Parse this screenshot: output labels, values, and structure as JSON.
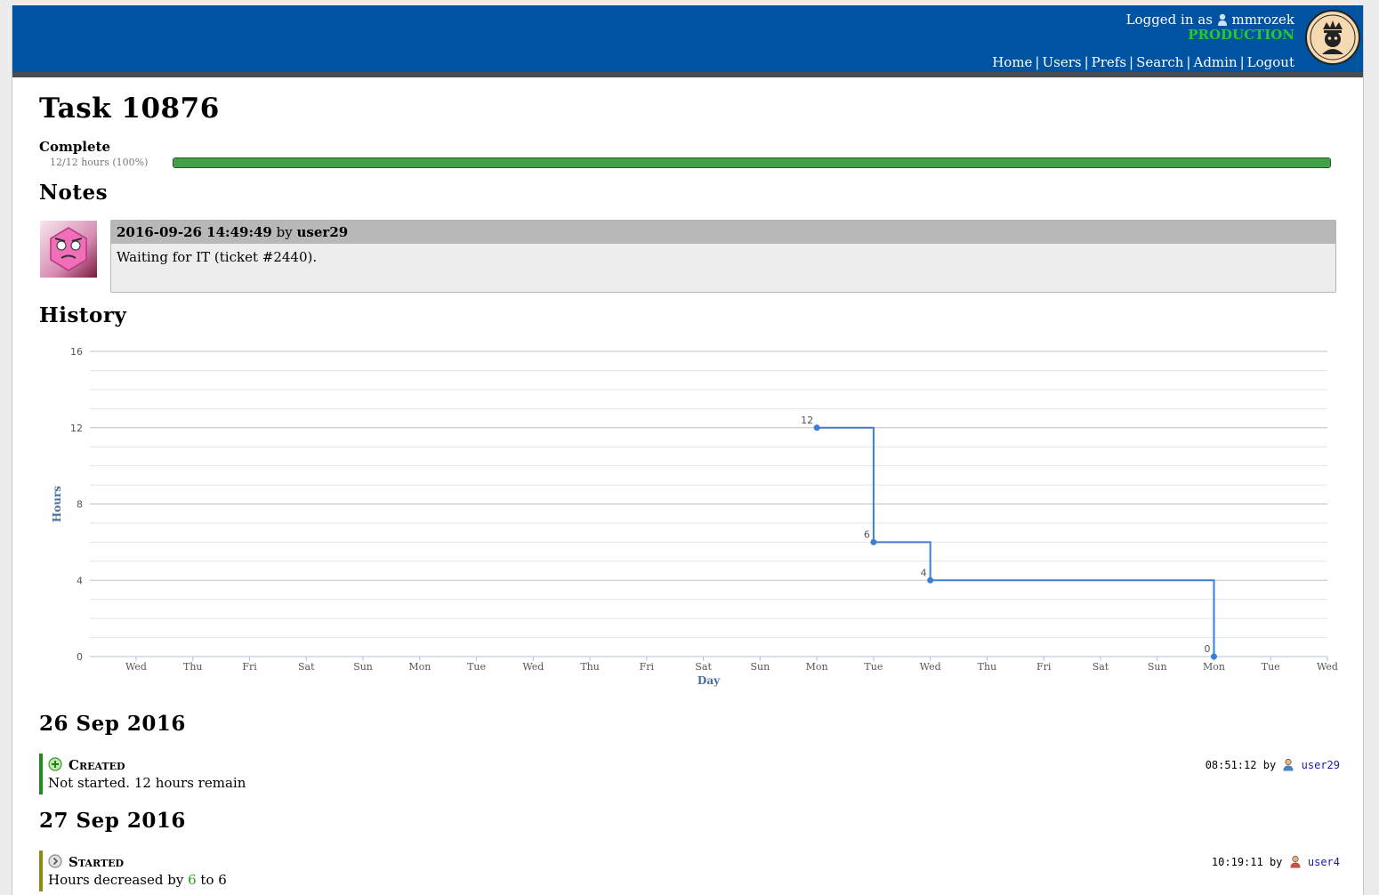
{
  "header": {
    "logged_in_prefix": "Logged in as",
    "username": "mmrozek",
    "environment": "PRODUCTION",
    "nav": [
      "Home",
      "Users",
      "Prefs",
      "Search",
      "Admin",
      "Logout"
    ],
    "colors": {
      "bar": "#0053a0",
      "environment": "#22c93a"
    }
  },
  "task": {
    "title": "Task 10876",
    "status": "Complete",
    "progress_text": "12/12 hours (100%)",
    "progress_fraction": 1.0
  },
  "notes": {
    "title": "Notes",
    "items": [
      {
        "timestamp": "2016-09-26 14:49:49",
        "by": "by",
        "author": "user29",
        "text": "Waiting for IT (ticket #2440)."
      }
    ]
  },
  "history": {
    "title": "History",
    "chart_data": {
      "type": "line",
      "step": true,
      "xlabel": "Day",
      "ylabel": "Hours",
      "ylim": [
        0,
        16
      ],
      "yticks": [
        0,
        4,
        8,
        12,
        16
      ],
      "categories": [
        "Wed",
        "Thu",
        "Fri",
        "Sat",
        "Sun",
        "Mon",
        "Tue",
        "Wed",
        "Thu",
        "Fri",
        "Sat",
        "Sun",
        "Mon",
        "Tue",
        "Wed",
        "Thu",
        "Fri",
        "Sat",
        "Sun",
        "Mon",
        "Tue",
        "Wed"
      ],
      "series": [
        {
          "points": [
            {
              "x_index": 12,
              "y": 12
            },
            {
              "x_index": 13,
              "y": 6
            },
            {
              "x_index": 14,
              "y": 4
            },
            {
              "x_index": 19,
              "y": 0
            }
          ]
        }
      ],
      "grid": true,
      "line_color": "#3a7fd5"
    },
    "days": [
      {
        "date": "26 Sep 2016",
        "events": [
          {
            "type": "Created",
            "text": "Not started. 12 hours remain",
            "time": "08:51:12",
            "by": "by",
            "user": "user29",
            "color": "#1e8c1e"
          }
        ]
      },
      {
        "date": "27 Sep 2016",
        "events": [
          {
            "type": "Started",
            "text_prefix": "Hours decreased by",
            "delta": "6",
            "text_mid": "to",
            "new_value": "6",
            "time": "10:19:11",
            "by": "by",
            "user": "user4",
            "color": "#8c8c14"
          }
        ]
      }
    ]
  }
}
